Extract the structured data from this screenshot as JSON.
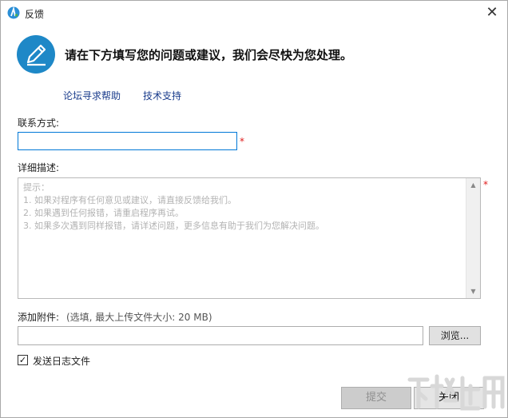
{
  "window": {
    "title": "反馈"
  },
  "header": {
    "message": "请在下方填写您的问题或建议，我们会尽快为您处理。"
  },
  "links": {
    "forum": "论坛寻求帮助",
    "support": "技术支持"
  },
  "contact": {
    "label": "联系方式:",
    "value": "",
    "required_mark": "*"
  },
  "description": {
    "label": "详细描述:",
    "required_mark": "*",
    "placeholder_lines": [
      "提示：",
      "1. 如果对程序有任何意见或建议，请直接反馈给我们。",
      "2. 如果遇到任何报错，请重启程序再试。",
      "3. 如果多次遇到同样报错，请详述问题，更多信息有助于我们为您解决问题。"
    ]
  },
  "attachment": {
    "label": "添加附件:",
    "hint": "(选填, 最大上传文件大小: 20 MB)",
    "browse_label": "浏览..."
  },
  "send_log": {
    "checked": true,
    "label": "发送日志文件"
  },
  "buttons": {
    "submit": "提交",
    "close": "关闭"
  },
  "icons": {
    "app": "app-logo-icon",
    "hero": "pen-edit-icon",
    "close": "close-icon"
  },
  "colors": {
    "accent": "#1e88c7",
    "link": "#1a3c8c",
    "required": "#e01b1b"
  }
}
